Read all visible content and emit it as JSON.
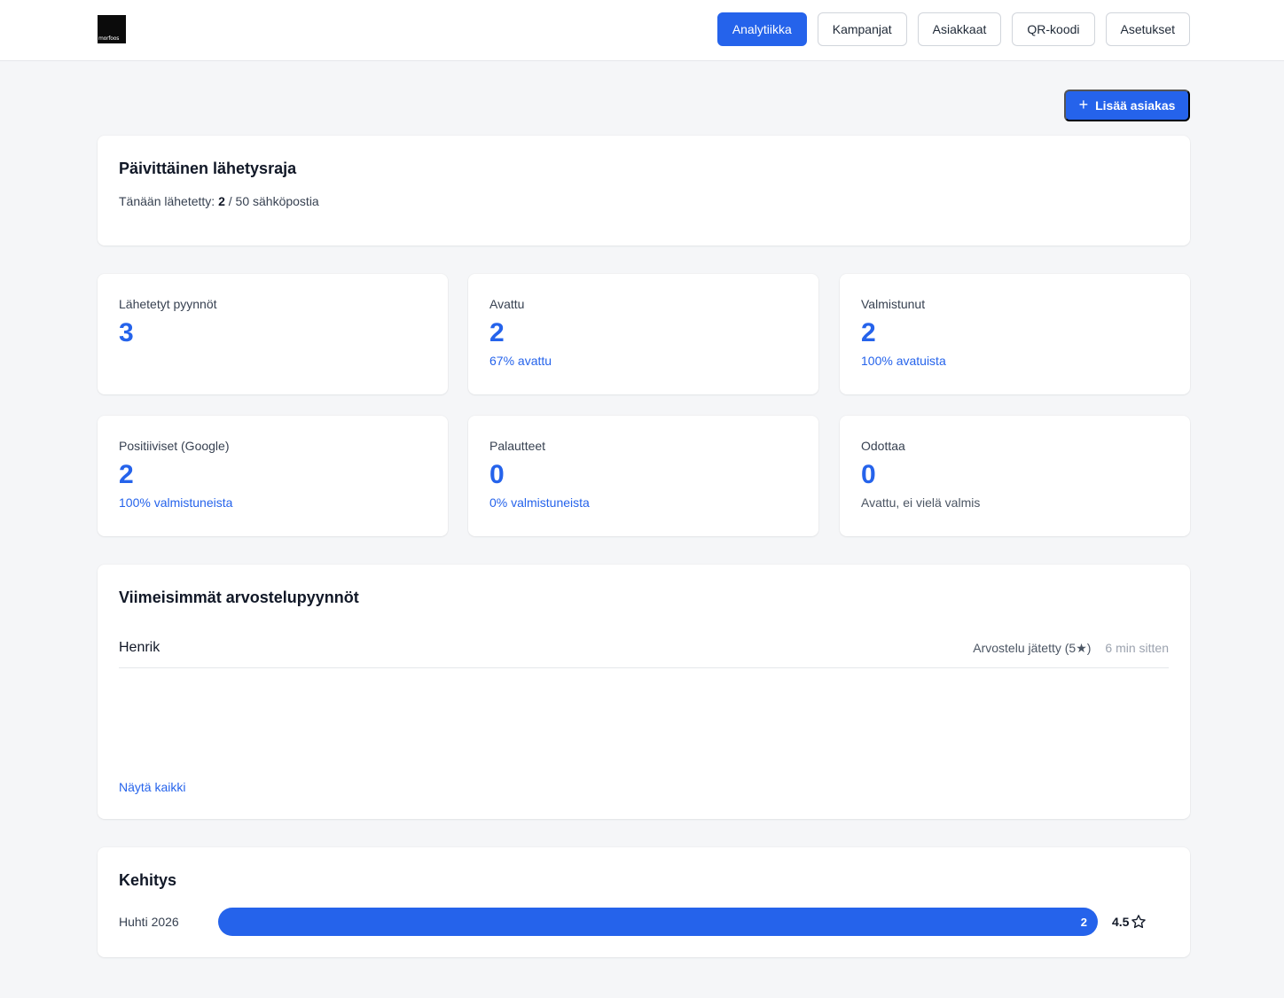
{
  "brand": {
    "logo_text": "morfoos"
  },
  "nav": [
    {
      "label": "Analytiikka",
      "active": true
    },
    {
      "label": "Kampanjat",
      "active": false
    },
    {
      "label": "Asiakkaat",
      "active": false
    },
    {
      "label": "QR-koodi",
      "active": false
    },
    {
      "label": "Asetukset",
      "active": false
    }
  ],
  "add_button": {
    "label": "Lisää asiakas",
    "icon": "plus-icon"
  },
  "daily_limit": {
    "title": "Päivittäinen lähetysraja",
    "prefix": "Tänään lähetetty: ",
    "sent": "2",
    "suffix": " / 50 sähköpostia"
  },
  "stats": [
    {
      "label": "Lähetetyt pyynnöt",
      "value": "3",
      "sub": ""
    },
    {
      "label": "Avattu",
      "value": "2",
      "sub": "67% avattu"
    },
    {
      "label": "Valmistunut",
      "value": "2",
      "sub": "100% avatuista"
    },
    {
      "label": "Positiiviset (Google)",
      "value": "2",
      "sub": "100% valmistuneista"
    },
    {
      "label": "Palautteet",
      "value": "0",
      "sub": "0% valmistuneista"
    },
    {
      "label": "Odottaa",
      "value": "0",
      "sub": "Avattu, ei vielä valmis"
    }
  ],
  "recent": {
    "title": "Viimeisimmät arvostelupyynnöt",
    "items": [
      {
        "name": "Henrik",
        "status": "Arvostelu jätetty (5★)",
        "time": "6 min sitten"
      }
    ],
    "show_all": "Näytä kaikki"
  },
  "trend": {
    "title": "Kehitys",
    "rows": [
      {
        "month": "Huhti 2026",
        "count": "2",
        "fill_fraction": 1.0,
        "rating": "4.5",
        "rating_icon": "star-outline-icon"
      }
    ]
  },
  "colors": {
    "accent": "#2563eb",
    "background": "#f5f6f8",
    "card": "#ffffff"
  }
}
